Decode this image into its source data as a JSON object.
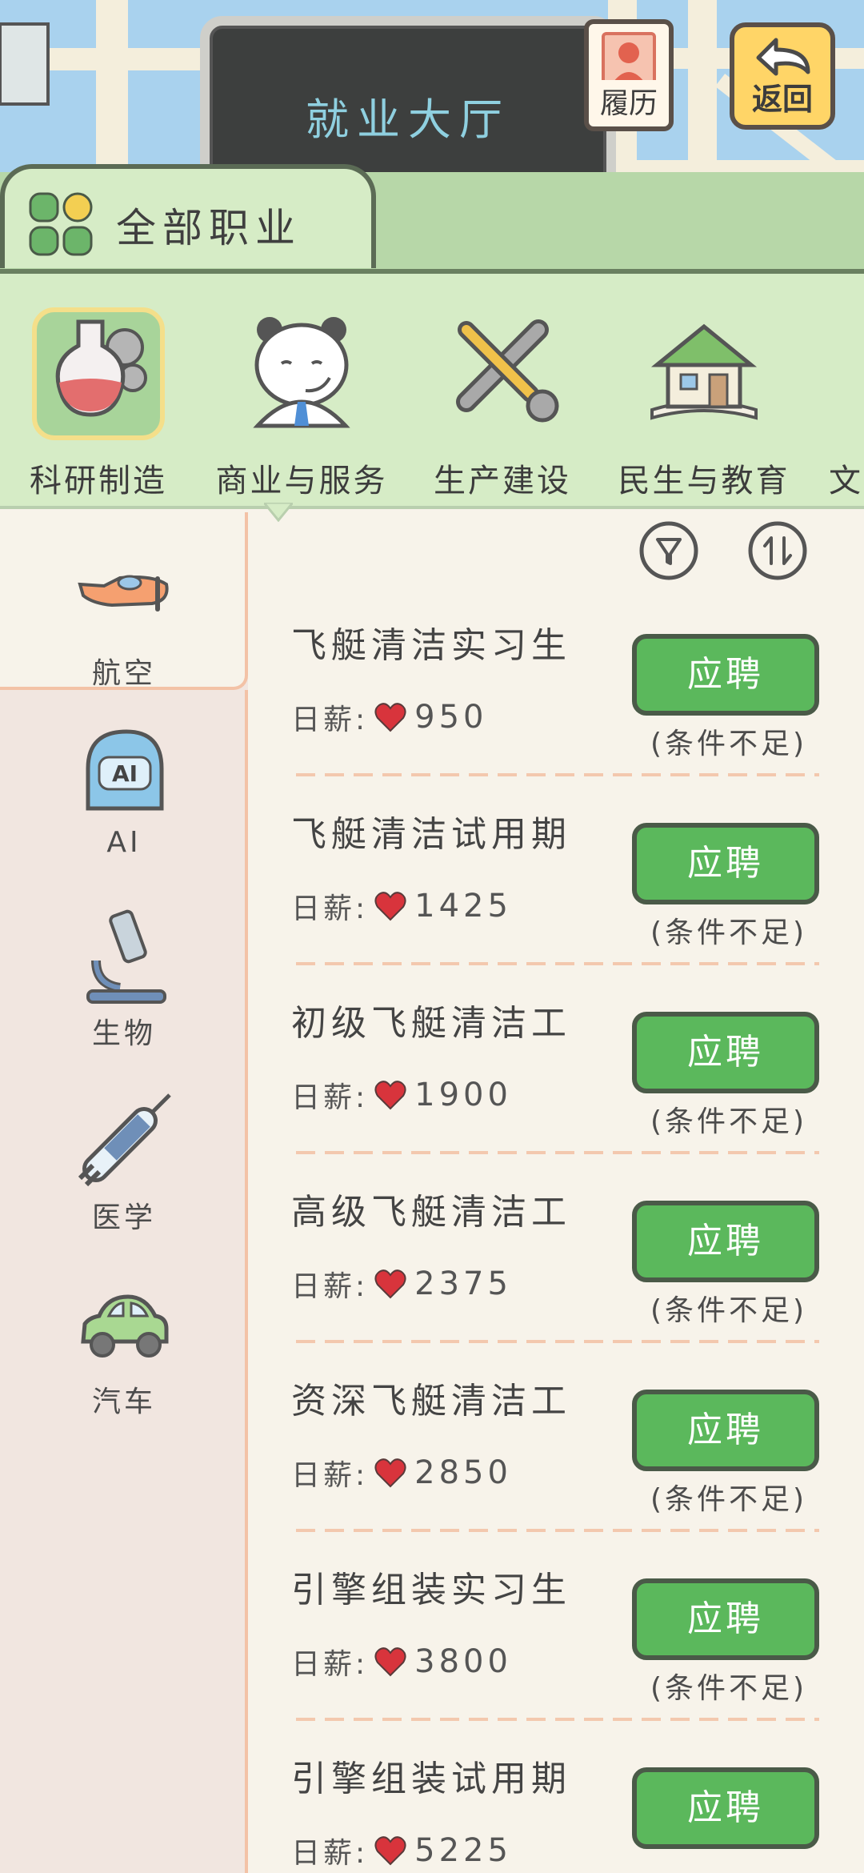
{
  "header": {
    "board_title": "就业大厅",
    "resume_label": "履历",
    "back_label": "返回"
  },
  "category_tab": {
    "label": "全部职业"
  },
  "categories": [
    {
      "label": "科研制造",
      "icon": "flask-gear-icon",
      "selected": true
    },
    {
      "label": "商业与服务",
      "icon": "panda-headset-icon",
      "selected": false
    },
    {
      "label": "生产建设",
      "icon": "tools-icon",
      "selected": false
    },
    {
      "label": "民生与教育",
      "icon": "house-book-icon",
      "selected": false
    },
    {
      "label": "文",
      "icon": "partial-icon",
      "selected": false
    }
  ],
  "subcategories": [
    {
      "label": "航空",
      "icon": "airplane-icon",
      "selected": true
    },
    {
      "label": "AI",
      "icon": "ai-head-icon",
      "selected": false
    },
    {
      "label": "生物",
      "icon": "microscope-icon",
      "selected": false
    },
    {
      "label": "医学",
      "icon": "syringe-icon",
      "selected": false
    },
    {
      "label": "汽车",
      "icon": "car-icon",
      "selected": false
    }
  ],
  "list_controls": {
    "filter_icon": "filter-icon",
    "sort_icon": "sort-icon"
  },
  "jobs": [
    {
      "title": "飞艇清洁实习生",
      "salary_label": "日薪:",
      "salary": "950",
      "apply": "应聘",
      "status": "(条件不足)"
    },
    {
      "title": "飞艇清洁试用期",
      "salary_label": "日薪:",
      "salary": "1425",
      "apply": "应聘",
      "status": "(条件不足)"
    },
    {
      "title": "初级飞艇清洁工",
      "salary_label": "日薪:",
      "salary": "1900",
      "apply": "应聘",
      "status": "(条件不足)"
    },
    {
      "title": "高级飞艇清洁工",
      "salary_label": "日薪:",
      "salary": "2375",
      "apply": "应聘",
      "status": "(条件不足)"
    },
    {
      "title": "资深飞艇清洁工",
      "salary_label": "日薪:",
      "salary": "2850",
      "apply": "应聘",
      "status": "(条件不足)"
    },
    {
      "title": "引擎组装实习生",
      "salary_label": "日薪:",
      "salary": "3800",
      "apply": "应聘",
      "status": "(条件不足)"
    },
    {
      "title": "引擎组装试用期",
      "salary_label": "日薪:",
      "salary": "5225",
      "apply": "应聘",
      "status": ""
    }
  ],
  "colors": {
    "apply_button": "#5bb85c",
    "tab_green": "#d6ecc6",
    "heart": "#d8343c",
    "back_button": "#ffd567"
  }
}
